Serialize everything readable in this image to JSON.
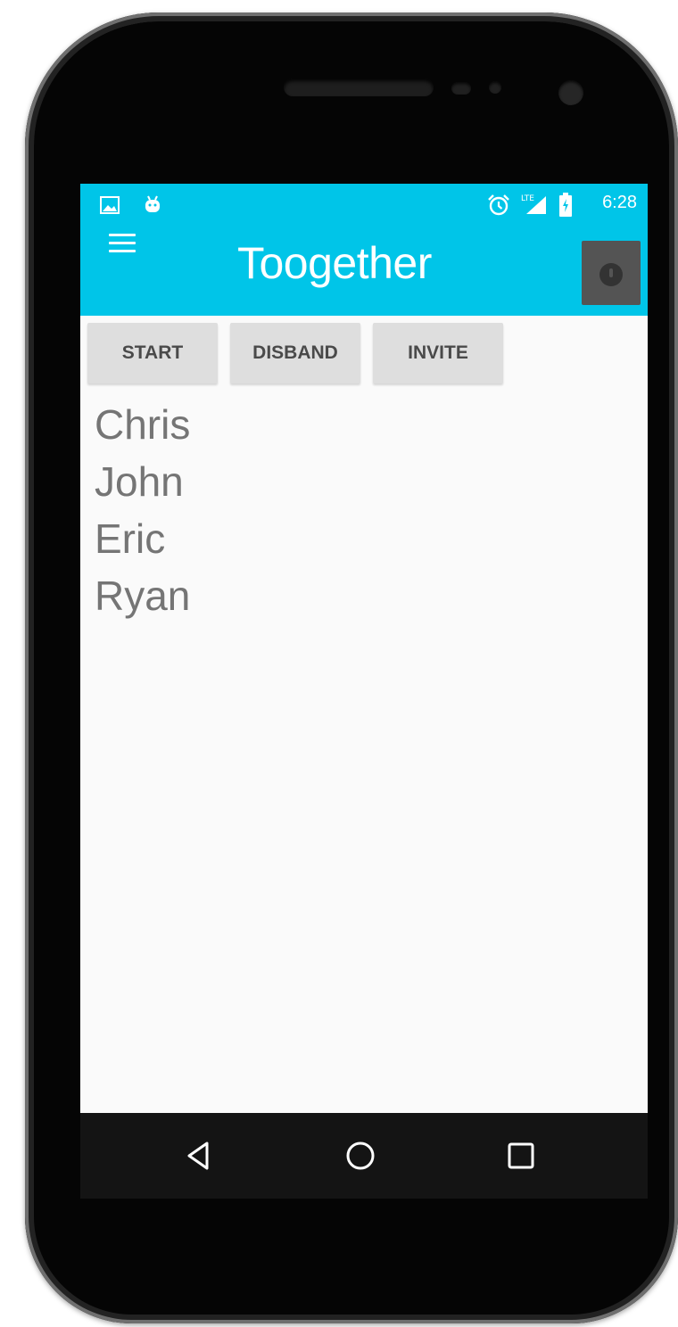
{
  "status_bar": {
    "time": "6:28",
    "icons": [
      "image-notification-icon",
      "android-icon",
      "alarm-icon",
      "lte-signal-icon",
      "battery-icon"
    ]
  },
  "app_bar": {
    "title": "Toogether",
    "menu_icon": "hamburger-menu-icon",
    "action_icon": "alert-icon",
    "background": "#00c5e8"
  },
  "buttons": [
    {
      "label": "START"
    },
    {
      "label": "DISBAND"
    },
    {
      "label": "INVITE"
    }
  ],
  "members": [
    "Chris",
    "John",
    "Eric",
    "Ryan"
  ],
  "nav_bar": {
    "icons": [
      "back-icon",
      "home-icon",
      "recents-icon"
    ]
  }
}
